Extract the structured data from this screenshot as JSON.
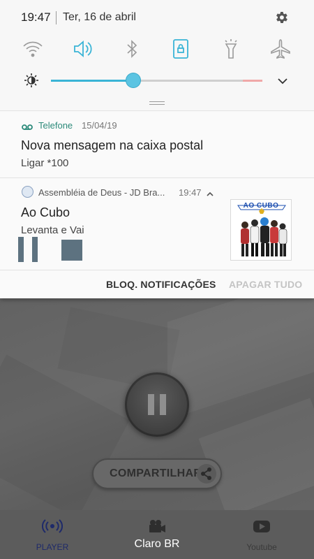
{
  "status_bar": {
    "time": "19:47",
    "date": "Ter, 16 de abril"
  },
  "quick_settings": {
    "tiles": [
      {
        "icon": "wifi-icon",
        "active": false
      },
      {
        "icon": "sound-icon",
        "active": true
      },
      {
        "icon": "bluetooth-icon",
        "active": false
      },
      {
        "icon": "screen-rotation-lock-icon",
        "active": true
      },
      {
        "icon": "flashlight-icon",
        "active": false
      },
      {
        "icon": "airplane-mode-icon",
        "active": false
      }
    ],
    "brightness_level": 0.39
  },
  "notifications": [
    {
      "app_name": "Telefone",
      "time": "15/04/19",
      "title": "Nova mensagem na caixa postal",
      "text": "Ligar *100"
    },
    {
      "app_name": "Assembléia de Deus - JD Bra...",
      "time": "19:47",
      "title": "Ao Cubo",
      "text": "Levanta e Vai",
      "album_art_text": "AO CUBO"
    }
  ],
  "shade_actions": {
    "block_label": "BLOQ. NOTIFICAÇÕES",
    "clear_label": "APAGAR TUDO"
  },
  "app": {
    "share_label": "COMPARTILHAR",
    "nav": [
      {
        "label": "PLAYER",
        "icon": "radio-broadcast-icon",
        "active": true
      },
      {
        "label": "",
        "icon": "video-camera-icon",
        "active": false
      },
      {
        "label": "Youtube",
        "icon": "youtube-icon",
        "active": false
      }
    ]
  },
  "toast": "Claro BR",
  "colors": {
    "accent": "#3ab4d6",
    "phone_app": "#2c8a7a",
    "media_controls": "#5d7280"
  }
}
